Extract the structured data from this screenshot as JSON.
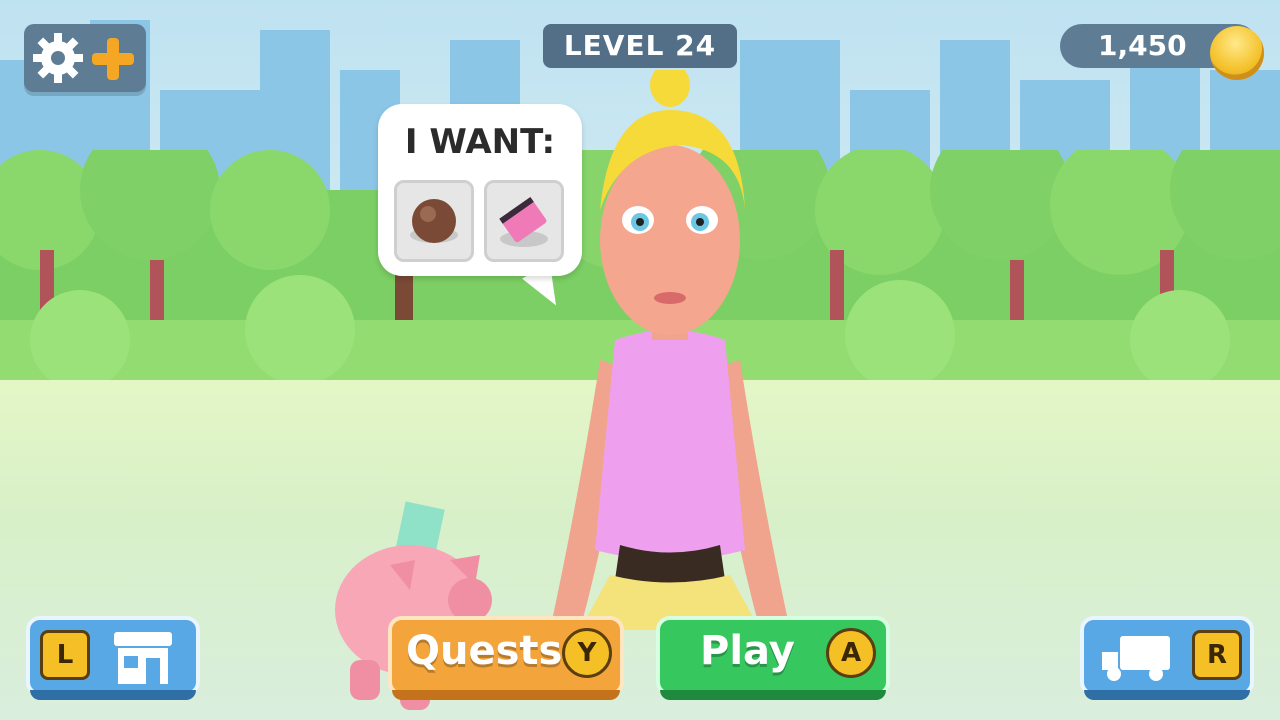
{
  "hud": {
    "level_label": "LEVEL 24",
    "coins": "1,450"
  },
  "speech_bubble": {
    "title": "I WANT:",
    "items": [
      {
        "icon": "brown-ball-icon"
      },
      {
        "icon": "pink-notebook-icon"
      }
    ]
  },
  "buttons": {
    "shop_key": "L",
    "quests_label": "Quests",
    "quests_key": "Y",
    "play_label": "Play",
    "play_key": "A",
    "truck_key": "R"
  },
  "colors": {
    "level_bg": "#536f88",
    "quests": "#f3a43b",
    "play": "#36c85f",
    "side_buttons": "#59a8e6",
    "accent_plus": "#f5a623"
  }
}
